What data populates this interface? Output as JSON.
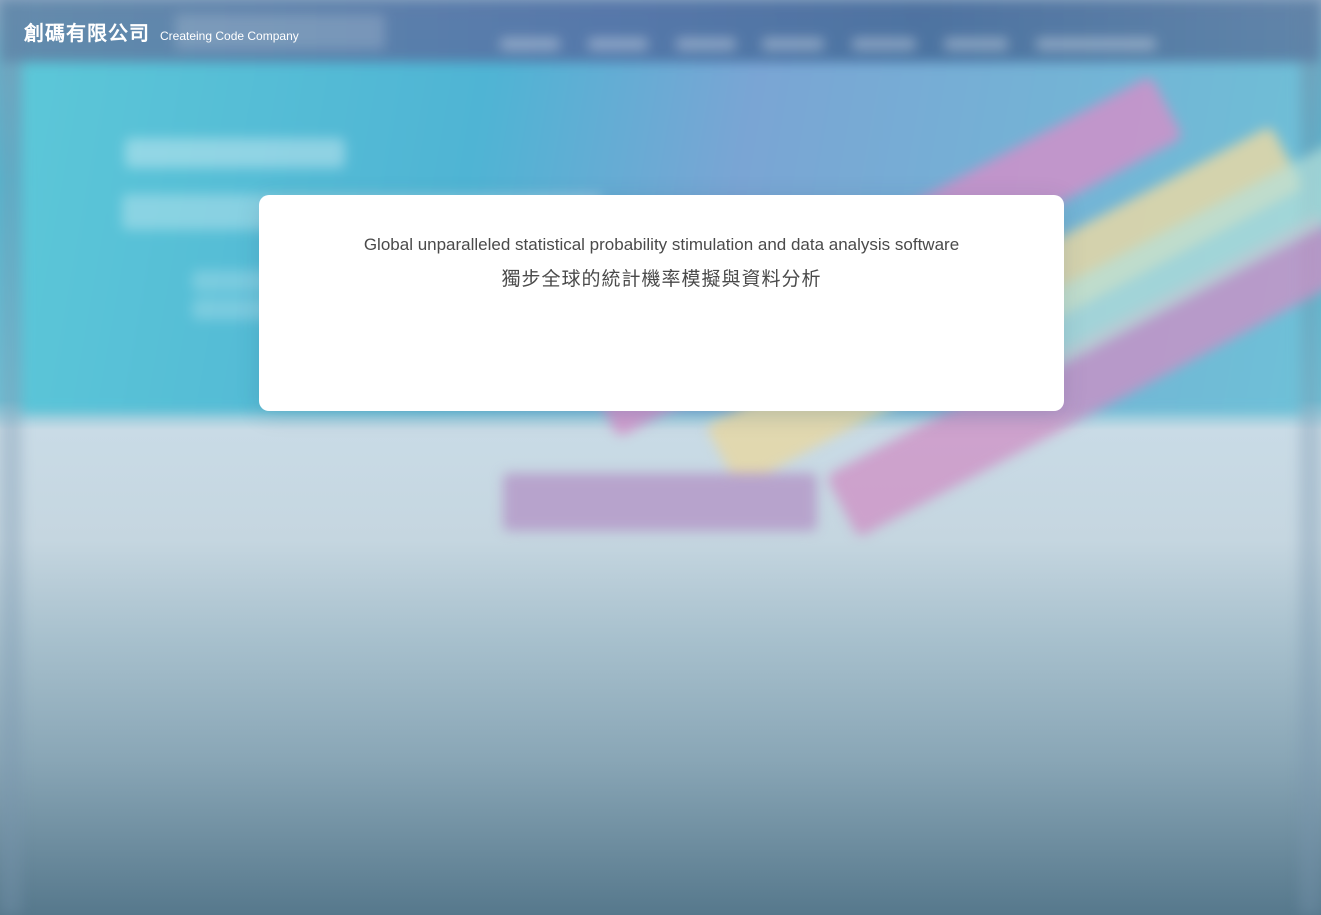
{
  "brand": {
    "name_cn": "創碼有限公司",
    "name_en": "Createing Code Company"
  },
  "modal": {
    "message_en": "Global unparalleled statistical probability stimulation and data analysis software",
    "message_cn": "獨步全球的統計機率模擬與資料分析"
  },
  "colors": {
    "modal_background": "#ffffff",
    "modal_text": "#4a4a4a",
    "brand_text": "#ffffff",
    "backdrop_top": "#6aaec8",
    "backdrop_bottom": "#56788c"
  }
}
